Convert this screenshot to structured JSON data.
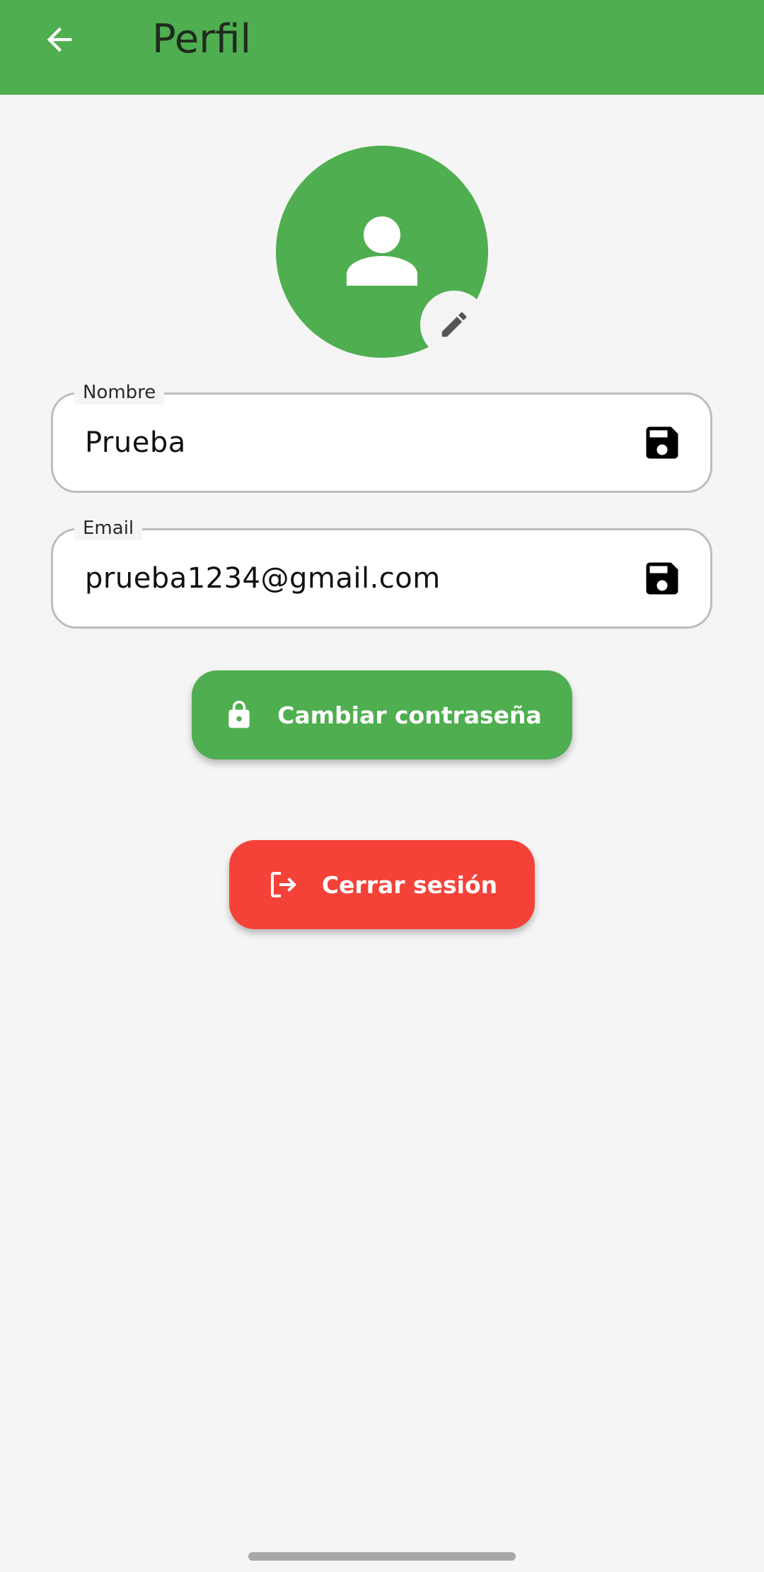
{
  "app_bar": {
    "title": "Perfil",
    "back_icon": "arrow-back-icon",
    "background_color": "#4fae4f"
  },
  "avatar": {
    "icon": "person-icon",
    "edit_icon": "pencil-icon",
    "color": "#4fae4f"
  },
  "form": {
    "name": {
      "label": "Nombre",
      "value": "Prueba",
      "action_icon": "save-icon"
    },
    "email": {
      "label": "Email",
      "value": "prueba1234@gmail.com",
      "action_icon": "save-icon"
    }
  },
  "actions": {
    "change_password": {
      "label": "Cambiar contraseña",
      "icon": "lock-icon",
      "color": "#4fae4f"
    },
    "logout": {
      "label": "Cerrar sesión",
      "icon": "logout-icon",
      "color": "#f44238"
    }
  }
}
